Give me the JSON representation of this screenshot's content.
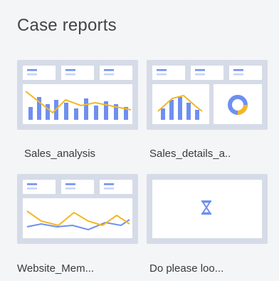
{
  "section": {
    "title": "Case reports"
  },
  "reports": [
    {
      "name": "Sales_analysis"
    },
    {
      "name": "Sales_details_a.."
    },
    {
      "name": "Website_Mem..."
    },
    {
      "name": "Do please loo..."
    }
  ],
  "colors": {
    "background": "#f4f5f7",
    "thumb_frame": "#d6dbe8",
    "thumb_panel": "#ffffff",
    "accent_blue": "#6f8ff0",
    "accent_yellow": "#f2b824",
    "light_blue": "#c6d3f8"
  },
  "icons": {
    "report4": "hourglass-icon"
  }
}
